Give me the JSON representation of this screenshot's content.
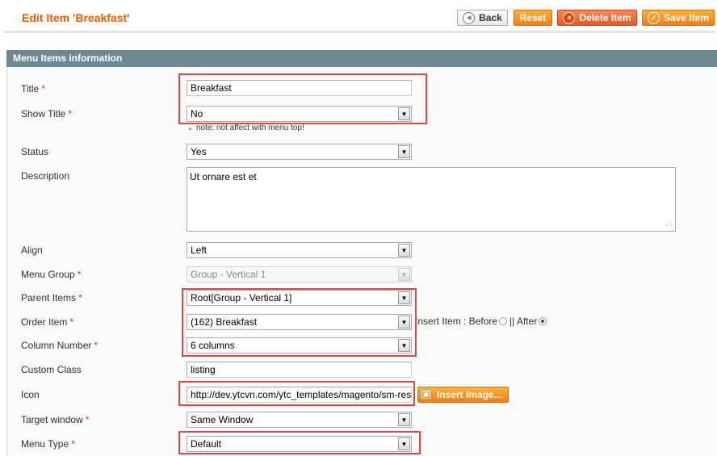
{
  "header": {
    "title": "Edit Item 'Breakfast'",
    "buttons": {
      "back": "Back",
      "reset": "Reset",
      "delete": "Delete Item",
      "save": "Save Item"
    }
  },
  "section": {
    "title": "Menu Items information"
  },
  "form": {
    "title": {
      "label": "Title",
      "required": "*",
      "value": "Breakfast"
    },
    "show_title": {
      "label": "Show Title",
      "required": "*",
      "value": "No",
      "note": "note: not affect with menu top!"
    },
    "status": {
      "label": "Status",
      "value": "Yes"
    },
    "description": {
      "label": "Description",
      "value": "Ut ornare est et"
    },
    "align": {
      "label": "Align",
      "value": "Left"
    },
    "menu_group": {
      "label": "Menu Group",
      "required": "*",
      "value": "Group - Vertical 1"
    },
    "parent_items": {
      "label": "Parent Items",
      "required": "*",
      "value": "Root[Group - Vertical 1]"
    },
    "order_item": {
      "label": "Order Item",
      "required": "*",
      "value": "(162) Breakfast",
      "insert_label": "Insert Item : Before",
      "separator": "|| After",
      "selected_position": "After"
    },
    "column_number": {
      "label": "Column Number",
      "required": "*",
      "value": "6 columns"
    },
    "custom_class": {
      "label": "Custom Class",
      "value": "listing"
    },
    "icon": {
      "label": "Icon",
      "value": "http://dev.ytcvn.com/ytc_templates/magento/sm-res",
      "button": "Insert Image..."
    },
    "target_window": {
      "label": "Target window",
      "required": "*",
      "value": "Same Window"
    },
    "menu_type": {
      "label": "Menu Type",
      "required": "*",
      "value": "Default"
    }
  },
  "icons": {
    "back": "back-arrow-icon",
    "delete": "delete-icon",
    "save": "save-check-icon",
    "insert_image": "image-icon",
    "dropdown": "dropdown-arrow-icon"
  },
  "colors": {
    "title": "#eb5e00",
    "section_bar": "#6f8992",
    "button_orange": "#f47d16",
    "button_red": "#e8581f",
    "required": "#eb340a",
    "highlight": "#e04848"
  }
}
